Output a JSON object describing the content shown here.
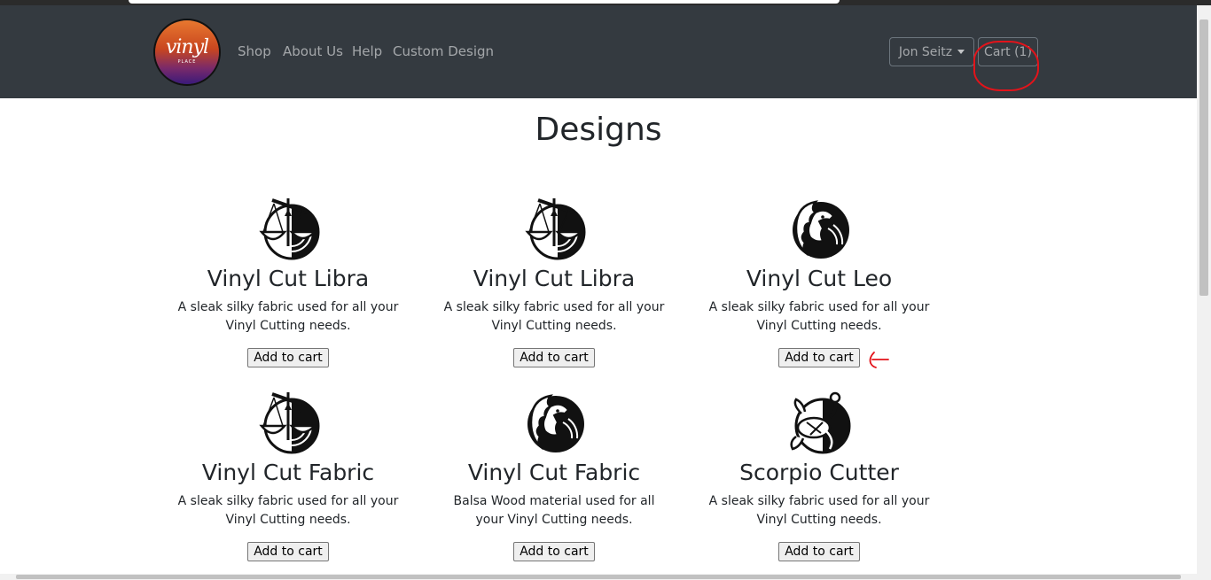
{
  "brand": {
    "logo_text": "vinyl",
    "logo_subtext": "PLACE"
  },
  "nav": {
    "links": [
      "Shop",
      "About Us",
      "Help",
      "Custom Design"
    ],
    "user_label": "Jon Seitz",
    "cart_label": "Cart (1)"
  },
  "page": {
    "title": "Designs"
  },
  "products": [
    {
      "name": "Vinyl Cut Libra",
      "description": "A sleak silky fabric used for all your Vinyl Cutting needs.",
      "button": "Add to cart",
      "icon": "libra-scale-icon"
    },
    {
      "name": "Vinyl Cut Libra",
      "description": "A sleak silky fabric used for all your Vinyl Cutting needs.",
      "button": "Add to cart",
      "icon": "libra-scale-icon"
    },
    {
      "name": "Vinyl Cut Leo",
      "description": "A sleak silky fabric used for all your Vinyl Cutting needs.",
      "button": "Add to cart",
      "icon": "leo-lion-icon"
    },
    {
      "name": "Vinyl Cut Fabric",
      "description": "A sleak silky fabric used for all your Vinyl Cutting needs.",
      "button": "Add to cart",
      "icon": "libra-scale-icon"
    },
    {
      "name": "Vinyl Cut Fabric",
      "description": "Balsa Wood material used for all your Vinyl Cutting needs.",
      "button": "Add to cart",
      "icon": "leo-lion-icon"
    },
    {
      "name": "Scorpio Cutter",
      "description": "A sleak silky fabric used for all your Vinyl Cutting needs.",
      "button": "Add to cart",
      "icon": "scorpio-icon"
    }
  ],
  "colors": {
    "navbar": "#343a40",
    "annotation_red": "#e3131a"
  }
}
